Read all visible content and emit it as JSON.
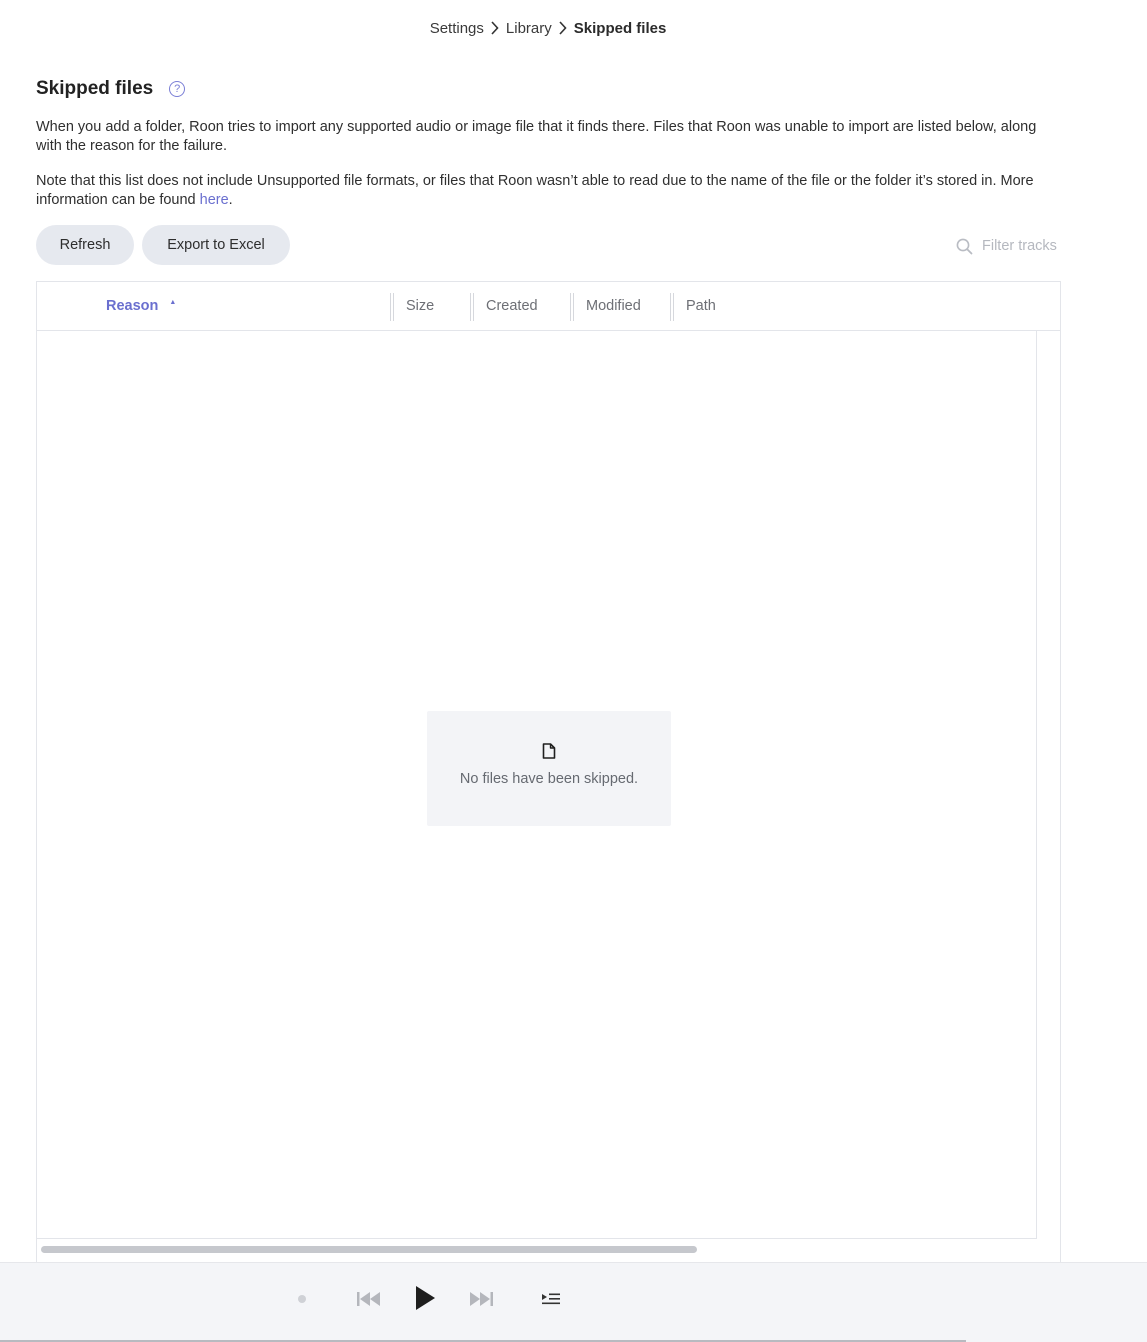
{
  "breadcrumb": {
    "items": [
      "Settings",
      "Library"
    ],
    "current": "Skipped files"
  },
  "header": {
    "title": "Skipped files",
    "help_icon_label": "?"
  },
  "description": {
    "para1": "When you add a folder, Roon tries to import any supported audio or image file that it finds there. Files that Roon was unable to import are listed below, along with the reason for the failure.",
    "para2_text": "Note that this list does not include Unsupported file formats, or files that Roon wasn’t able to read due to the name of the file or the folder it’s stored in. More information can be found ",
    "para2_link": "here",
    "para2_end": "."
  },
  "toolbar": {
    "refresh_label": "Refresh",
    "export_label": "Export to Excel",
    "filter_placeholder": "Filter tracks",
    "filter_value": ""
  },
  "table": {
    "columns": [
      "Reason",
      "Size",
      "Created",
      "Modified",
      "Path"
    ],
    "sorted_column": "Reason",
    "sort_direction_glyph": "▲",
    "rows": [],
    "empty_message": "No files have been skipped."
  },
  "player": {
    "controls": [
      "status-dot",
      "previous",
      "play",
      "next",
      "queue"
    ]
  },
  "colors": {
    "accent": "#6a6fcf",
    "button_bg": "#e6e9ef",
    "empty_bg": "#f3f4f7",
    "player_bg": "#f4f5f8"
  }
}
